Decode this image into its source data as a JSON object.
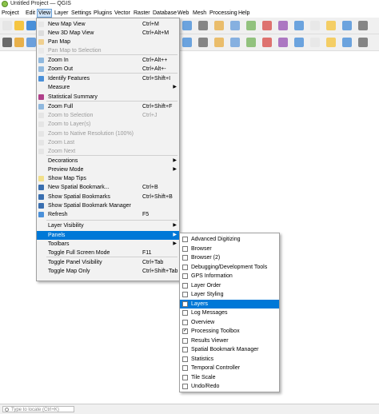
{
  "window": {
    "title": "Untitled Project — QGIS"
  },
  "menubar": [
    "Project",
    "Edit",
    "View",
    "Layer",
    "Settings",
    "Plugins",
    "Vector",
    "Raster",
    "Database",
    "Web",
    "Mesh",
    "Processing",
    "Help"
  ],
  "view_menu": [
    {
      "label": "New Map View",
      "shortcut": "Ctrl+M",
      "icon": "map-view-icon"
    },
    {
      "label": "New 3D Map View",
      "shortcut": "Ctrl+Alt+M",
      "icon": "3d-map-view-icon"
    },
    {
      "label": "Pan Map",
      "icon": "pan-hand-icon"
    },
    {
      "label": "Pan Map to Selection",
      "disabled": true,
      "icon": "pan-selection-icon"
    },
    {
      "label": "Zoom In",
      "shortcut": "Ctrl+Alt++",
      "icon": "zoom-in-icon"
    },
    {
      "label": "Zoom Out",
      "shortcut": "Ctrl+Alt+-",
      "icon": "zoom-out-icon"
    },
    {
      "label": "Identify Features",
      "shortcut": "Ctrl+Shift+I",
      "icon": "identify-icon"
    },
    {
      "label": "Measure",
      "submenu": true
    },
    {
      "label": "Statistical Summary",
      "icon": "sigma-icon"
    },
    {
      "label": "Zoom Full",
      "shortcut": "Ctrl+Shift+F",
      "icon": "zoom-full-icon"
    },
    {
      "label": "Zoom to Selection",
      "shortcut": "Ctrl+J",
      "disabled": true,
      "icon": "zoom-selection-icon"
    },
    {
      "label": "Zoom to Layer(s)",
      "disabled": true,
      "icon": "zoom-layer-icon"
    },
    {
      "label": "Zoom to Native Resolution (100%)",
      "disabled": true,
      "icon": "zoom-native-icon"
    },
    {
      "label": "Zoom Last",
      "disabled": true,
      "icon": "zoom-last-icon"
    },
    {
      "label": "Zoom Next",
      "disabled": true,
      "icon": "zoom-next-icon"
    },
    {
      "label": "Decorations",
      "submenu": true
    },
    {
      "label": "Preview Mode",
      "submenu": true
    },
    {
      "label": "Show Map Tips",
      "icon": "map-tips-icon"
    },
    {
      "label": "New Spatial Bookmark...",
      "shortcut": "Ctrl+B",
      "icon": "bookmark-new-icon"
    },
    {
      "label": "Show Spatial Bookmarks",
      "shortcut": "Ctrl+Shift+B",
      "icon": "bookmarks-icon"
    },
    {
      "label": "Show Spatial Bookmark Manager",
      "icon": "bookmark-manager-icon"
    },
    {
      "label": "Refresh",
      "shortcut": "F5",
      "icon": "refresh-icon"
    },
    {
      "label": "Layer Visibility",
      "submenu": true
    },
    {
      "label": "Panels",
      "submenu": true,
      "highlighted": true
    },
    {
      "label": "Toolbars",
      "submenu": true
    },
    {
      "label": "Toggle Full Screen Mode",
      "shortcut": "F11"
    },
    {
      "label": "Toggle Panel Visibility",
      "shortcut": "Ctrl+Tab"
    },
    {
      "label": "Toggle Map Only",
      "shortcut": "Ctrl+Shift+Tab"
    }
  ],
  "panels_menu": [
    {
      "label": "Advanced Digitizing",
      "checked": false
    },
    {
      "label": "Browser",
      "checked": false
    },
    {
      "label": "Browser (2)",
      "checked": false
    },
    {
      "label": "Debugging/Development Tools",
      "checked": false
    },
    {
      "label": "GPS Information",
      "checked": false
    },
    {
      "label": "Layer Order",
      "checked": false
    },
    {
      "label": "Layer Styling",
      "checked": false
    },
    {
      "label": "Layers",
      "checked": false,
      "highlighted": true
    },
    {
      "label": "Log Messages",
      "checked": false
    },
    {
      "label": "Overview",
      "checked": false
    },
    {
      "label": "Processing Toolbox",
      "checked": true
    },
    {
      "label": "Results Viewer",
      "checked": false
    },
    {
      "label": "Spatial Bookmark Manager",
      "checked": false
    },
    {
      "label": "Statistics",
      "checked": false
    },
    {
      "label": "Temporal Controller",
      "checked": false
    },
    {
      "label": "Tile Scale",
      "checked": false
    },
    {
      "label": "Undo/Redo",
      "checked": false
    }
  ],
  "status": {
    "locator_placeholder": "Type to locate (Ctrl+K)"
  },
  "colors": {
    "highlight": "#0078d7",
    "menu_bg": "#f2f2f2"
  }
}
